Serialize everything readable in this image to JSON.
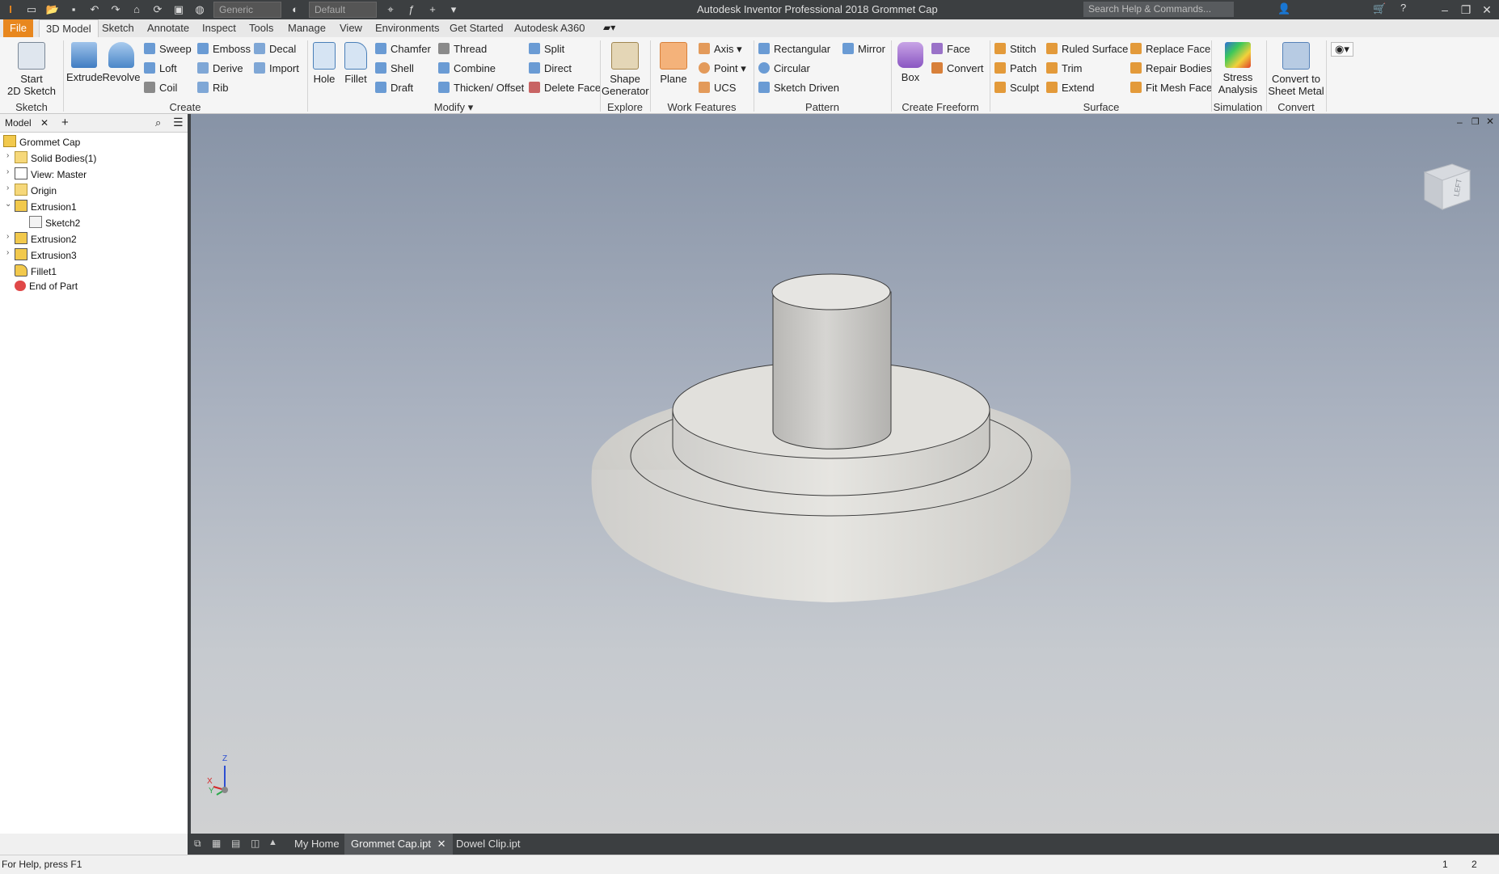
{
  "app": {
    "title": "Autodesk Inventor Professional 2018   Grommet Cap",
    "search_placeholder": "Search Help & Commands...",
    "material_combo": "Generic",
    "appearance_combo": "Default"
  },
  "tabs": [
    "File",
    "3D Model",
    "Sketch",
    "Annotate",
    "Inspect",
    "Tools",
    "Manage",
    "View",
    "Environments",
    "Get Started",
    "Autodesk A360"
  ],
  "ribbon": {
    "sketch": {
      "start_sketch": "Start\n2D Sketch",
      "group": "Sketch"
    },
    "create": {
      "extrude": "Extrude",
      "revolve": "Revolve",
      "sweep": "Sweep",
      "loft": "Loft",
      "coil": "Coil",
      "emboss": "Emboss",
      "derive": "Derive",
      "rib": "Rib",
      "decal": "Decal",
      "import": "Import",
      "group": "Create"
    },
    "modify": {
      "hole": "Hole",
      "fillet": "Fillet",
      "chamfer": "Chamfer",
      "shell": "Shell",
      "draft": "Draft",
      "thread": "Thread",
      "combine": "Combine",
      "thicken": "Thicken/ Offset",
      "split": "Split",
      "direct": "Direct",
      "delete_face": "Delete Face",
      "group": "Modify"
    },
    "explore": {
      "shape_generator": "Shape\nGenerator",
      "group": "Explore"
    },
    "work_features": {
      "plane": "Plane",
      "axis": "Axis",
      "point": "Point",
      "ucs": "UCS",
      "group": "Work Features"
    },
    "pattern": {
      "rectangular": "Rectangular",
      "circular": "Circular",
      "sketch_driven": "Sketch Driven",
      "mirror": "Mirror",
      "group": "Pattern"
    },
    "freeform": {
      "box": "Box",
      "face": "Face",
      "convert": "Convert",
      "group": "Create Freeform"
    },
    "surface": {
      "stitch": "Stitch",
      "patch": "Patch",
      "sculpt": "Sculpt",
      "ruled_surface": "Ruled Surface",
      "trim": "Trim",
      "extend": "Extend",
      "replace_face": "Replace Face",
      "repair_bodies": "Repair Bodies",
      "fit_mesh_face": "Fit Mesh Face",
      "group": "Surface"
    },
    "simulation": {
      "stress": "Stress\nAnalysis",
      "group": "Simulation"
    },
    "convert": {
      "sheet_metal": "Convert to\nSheet Metal",
      "group": "Convert"
    }
  },
  "browser": {
    "tab": "Model",
    "items": [
      {
        "label": "Grommet Cap"
      },
      {
        "label": "Solid Bodies(1)"
      },
      {
        "label": "View: Master"
      },
      {
        "label": "Origin"
      },
      {
        "label": "Extrusion1"
      },
      {
        "label": "Sketch2"
      },
      {
        "label": "Extrusion2"
      },
      {
        "label": "Extrusion3"
      },
      {
        "label": "Fillet1"
      },
      {
        "label": "End of Part"
      }
    ]
  },
  "viewcube": {
    "face": "LEFT"
  },
  "triad": {
    "z": "Z",
    "x": "X",
    "y": "Y"
  },
  "doc_tabs": [
    "My Home",
    "Grommet Cap.ipt",
    "Dowel Clip.ipt"
  ],
  "status": {
    "help": "For Help, press F1",
    "count1": "1",
    "count2": "2"
  }
}
